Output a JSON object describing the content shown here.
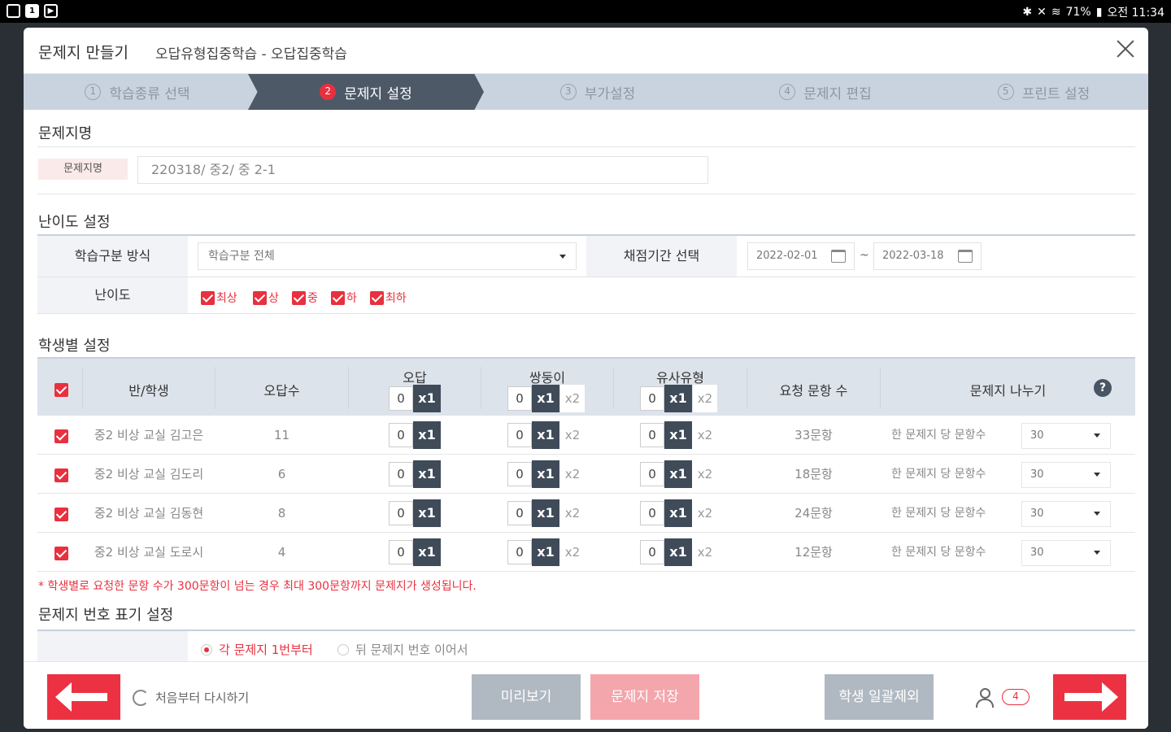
{
  "status_bar": {
    "battery": "71%",
    "time": "오전 11:34"
  },
  "dialog": {
    "title": "문제지 만들기",
    "subtitle": "오답유형집중학습 - 오답집중학습"
  },
  "steps": [
    {
      "num": "1",
      "label": "학습종류 선택"
    },
    {
      "num": "2",
      "label": "문제지 설정"
    },
    {
      "num": "3",
      "label": "부가설정"
    },
    {
      "num": "4",
      "label": "문제지 편집"
    },
    {
      "num": "5",
      "label": "프린트 설정"
    }
  ],
  "name_section": {
    "title": "문제지명",
    "label": "문제지명",
    "value": "220318/ 중2/ 중 2-1"
  },
  "difficulty_section": {
    "title": "난이도 설정",
    "method_label": "학습구분 방식",
    "method_value": "학습구분 전체",
    "period_label": "채점기간 선택",
    "date_from": "2022-02-01",
    "date_sep": "~",
    "date_to": "2022-03-18",
    "level_label": "난이도",
    "levels": [
      "최상",
      "상",
      "중",
      "하",
      "최하"
    ]
  },
  "student_section": {
    "title": "학생별 설정",
    "headers": {
      "class_student": "반/학생",
      "wrong_count": "오답수",
      "wrong": "오답",
      "twin": "쌍둥이",
      "similar": "유사유형",
      "requested": "요청 문항 수",
      "split": "문제지 나누기"
    },
    "zero": "0",
    "x1": "x1",
    "x2": "x2",
    "help": "?",
    "split_label": "한 문제지 당 문항수",
    "rows": [
      {
        "name": "중2 비상 교실 김고은",
        "wrong_count": "11",
        "requested": "33문항",
        "split": "30"
      },
      {
        "name": "중2 비상 교실 김도리",
        "wrong_count": "6",
        "requested": "18문항",
        "split": "30"
      },
      {
        "name": "중2 비상 교실 김동현",
        "wrong_count": "8",
        "requested": "24문항",
        "split": "30"
      },
      {
        "name": "중2 비상 교실 도로시",
        "wrong_count": "4",
        "requested": "12문항",
        "split": "30"
      }
    ],
    "note": "* 학생별로 요청한 문항 수가 300문항이 넘는 경우 최대 300문항까지 문제지가 생성됩니다."
  },
  "numbering_section": {
    "title": "문제지 번호 표기 설정",
    "option_each": "각 문제지 1번부터",
    "option_continue": "뒤 문제지 번호 이어서"
  },
  "footer": {
    "restart": "처음부터 다시하기",
    "preview": "미리보기",
    "save": "문제지 저장",
    "exclude": "학생 일괄제외",
    "student_count": "4"
  },
  "colors": {
    "accent": "#e8303f",
    "step_active": "#4d5967",
    "steps_bg": "#c9d3df"
  }
}
